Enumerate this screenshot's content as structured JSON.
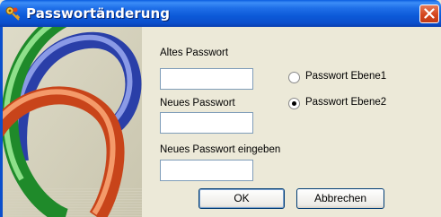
{
  "window": {
    "title": "Passwortänderung",
    "app_icon": "key-icon",
    "close_icon": "close-icon"
  },
  "form": {
    "old_password_label": "Altes Passwort",
    "old_password_value": "",
    "new_password_label": "Neues Passwort",
    "new_password_value": "",
    "confirm_password_label": "Neues Passwort eingeben",
    "confirm_password_value": ""
  },
  "level": {
    "options": [
      {
        "label": "Passwort Ebene1",
        "selected": false
      },
      {
        "label": "Passwort Ebene2",
        "selected": true
      }
    ]
  },
  "buttons": {
    "ok_label": "OK",
    "cancel_label": "Abbrechen"
  },
  "colors": {
    "title_blue": "#0b4fcc",
    "dialog_bg": "#ece9d8",
    "close_red": "#d4461e"
  }
}
